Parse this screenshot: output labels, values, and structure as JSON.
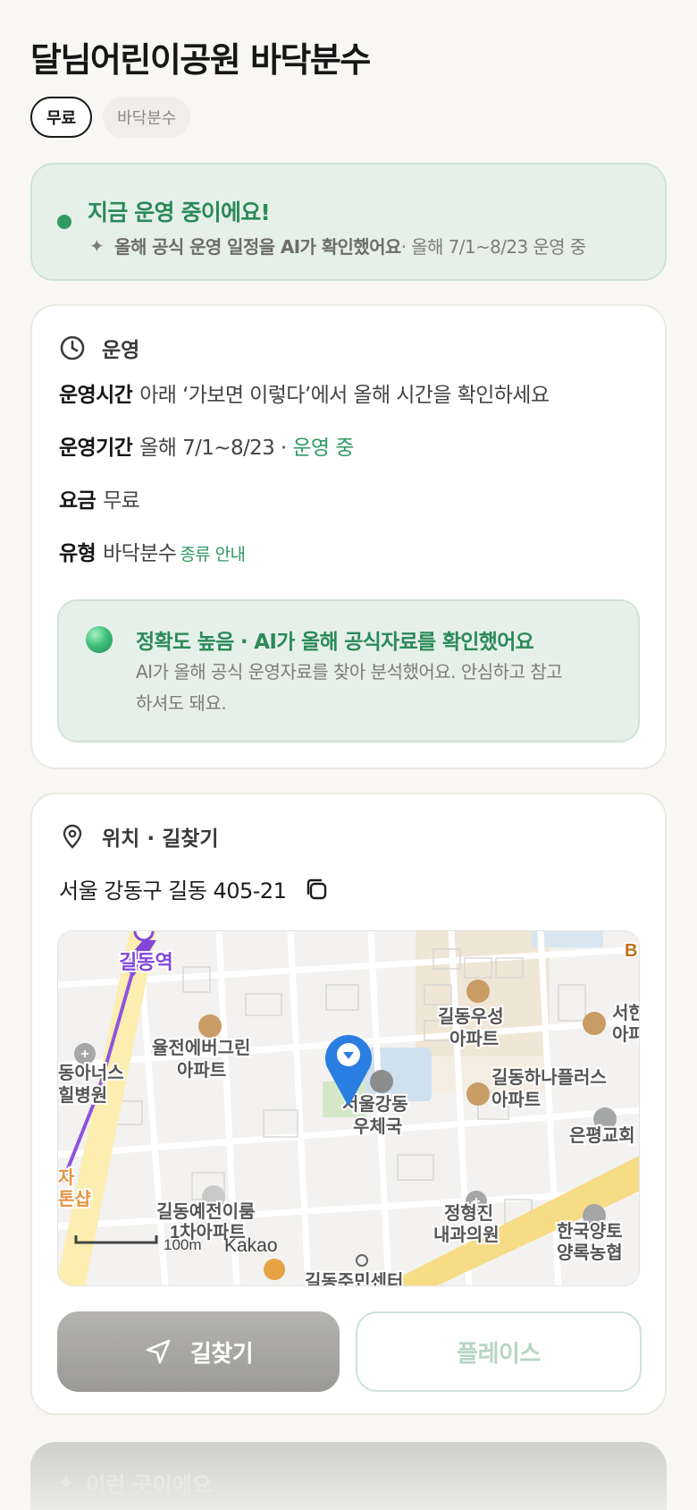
{
  "header": {
    "title": "달님어린이공원 바닥분수",
    "chips": [
      "무료",
      "바닥분수"
    ]
  },
  "status": {
    "headline": "지금 운영 중이에요!",
    "sub_bold": "올해 공식 운영 일정을 AI가 확인했어요",
    "sub_rest": " · 올해 7/1~8/23 운영 중"
  },
  "operation": {
    "section_title": "운영",
    "hours_label": "운영시간",
    "hours_value": "아래 ‘가보면 이렇다’에서 올해 시간을 확인하세요",
    "period_label": "운영기간",
    "period_value": "올해 7/1~8/23 · ",
    "period_status": "운영 중",
    "fee_label": "요금",
    "fee_value": "무료",
    "type_label": "유형",
    "type_value": "바닥분수",
    "type_link": "종류 안내",
    "accuracy_title": "정확도 높음 · AI가 올해 공식자료를 확인했어요",
    "accuracy_body": "AI가 올해 공식 운영자료를 찾아 분석했어요. 안심하고 참고하셔도 돼요."
  },
  "location": {
    "section_title": "위치 · 길찾기",
    "address": "서울 강동구 길동 405-21",
    "map": {
      "labels": {
        "station": "길동역",
        "apt1a": "율전에버그린",
        "apt1b": "아파트",
        "apt2a": "길동우성",
        "apt2b": "아파트",
        "apt3a": "길동하나플러스",
        "apt3b": "아파트",
        "post_a": "서울강동",
        "post_b": "우체국",
        "hosp_a": "동아너스",
        "hosp_b": "힐병원",
        "church": "은평교회",
        "apt4a": "길동예전이룸",
        "apt4b": "1차아파트",
        "clinic_a": "정형진",
        "clinic_b": "내과의원",
        "bank_a": "한국양토",
        "bank_b": "양록농협",
        "apt5a": "서한",
        "apt5b": "아파",
        "community": "길동주민센터",
        "edge_left1": "자",
        "edge_left2": "톤샵",
        "edge_b": "B",
        "scale": "100m",
        "brand": "Kakao"
      }
    },
    "route_button": "길찾기",
    "place_button": "플레이스"
  },
  "next_section": {
    "title": "이런 곳이에요"
  }
}
